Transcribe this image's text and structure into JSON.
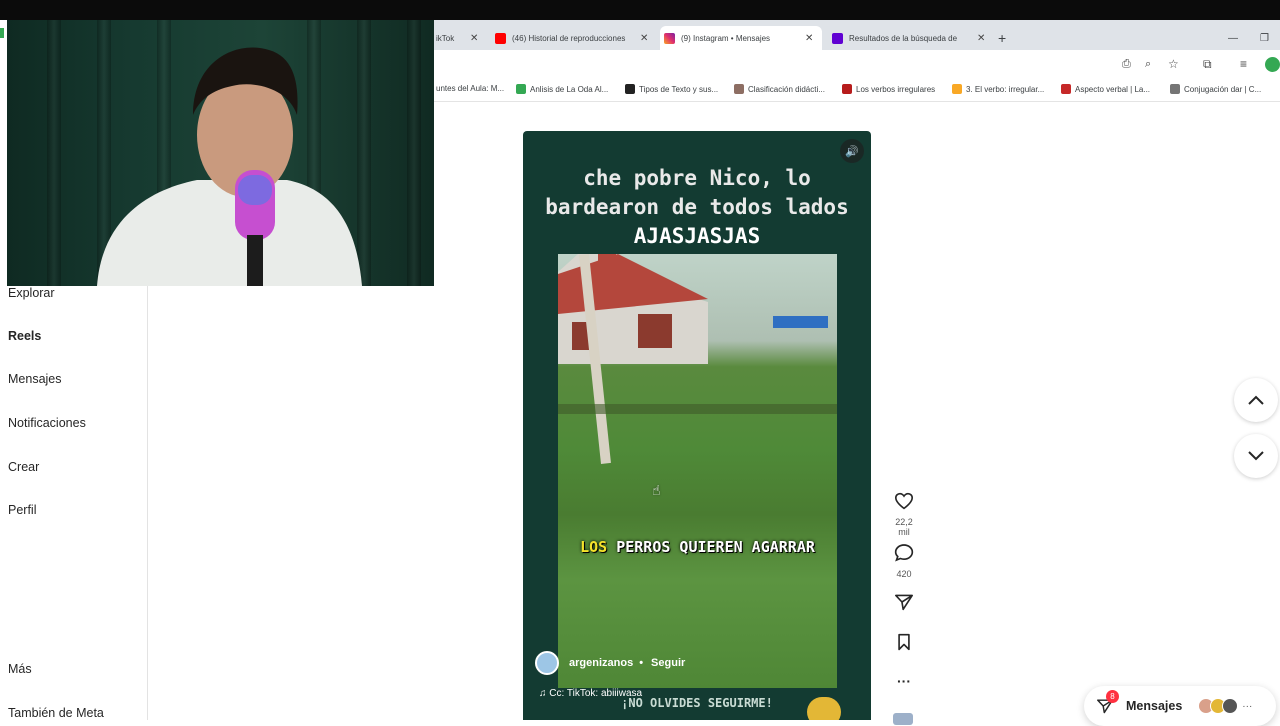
{
  "browser": {
    "tabs": [
      {
        "title": "ikTok",
        "favicon_color": "#111111"
      },
      {
        "title": "(46) Historial de reproducciones",
        "favicon_color": "#ff0000"
      },
      {
        "title": "(9) Instagram • Mensajes",
        "favicon_color": "#e1306c"
      },
      {
        "title": "Resultados de la búsqueda de",
        "favicon_color": "#6001d2"
      }
    ],
    "new_tab": "+",
    "close_glyph": "✕",
    "bookmarks": [
      {
        "title": "untes del Aula: M...",
        "color": "#888888"
      },
      {
        "title": "Anlisis de La Oda Al...",
        "color": "#34a853"
      },
      {
        "title": "Tipos de Texto y sus...",
        "color": "#222222"
      },
      {
        "title": "Clasificación didácti...",
        "color": "#8d6e63"
      },
      {
        "title": "Los verbos irregulares",
        "color": "#b71c1c"
      },
      {
        "title": "3. El verbo: irregular...",
        "color": "#f9a825"
      },
      {
        "title": "Aspecto verbal | La...",
        "color": "#c62828"
      },
      {
        "title": "Conjugación dar | C...",
        "color": "#757575"
      }
    ]
  },
  "sidebar": {
    "items": [
      {
        "label": "Explorar"
      },
      {
        "label": "Reels"
      },
      {
        "label": "Mensajes"
      },
      {
        "label": "Notificaciones"
      },
      {
        "label": "Crear"
      },
      {
        "label": "Perfil"
      },
      {
        "label": "Más"
      },
      {
        "label": "También de Meta"
      }
    ]
  },
  "reel": {
    "title_line1": "che pobre Nico, lo",
    "title_line2": "bardearon de todos lados",
    "title_line3": "AJASJASJAS",
    "caption_highlight": "LOS",
    "caption_rest": " PERROS QUIEREN AGARRAR",
    "author": "argenizanos",
    "dot": "•",
    "follow": "Seguir",
    "credit": "Cc: TikTok: abiiiwasa",
    "footer_banner": "¡NO OLVIDES SEGUIRME!"
  },
  "actions": {
    "likes": "22,2 mil",
    "comments": "420"
  },
  "messages": {
    "label": "Mensajes",
    "badge": "8"
  }
}
